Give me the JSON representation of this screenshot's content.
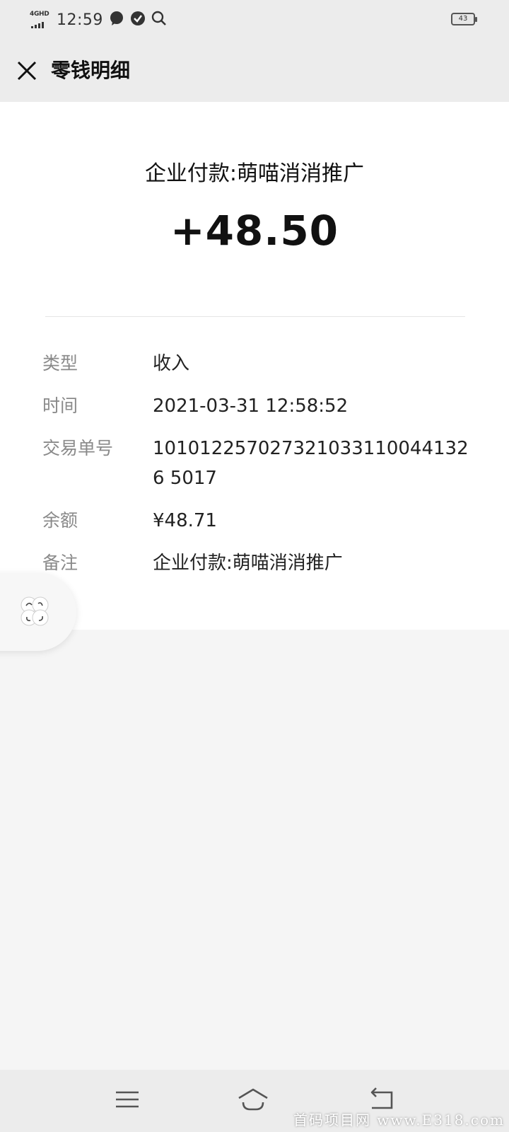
{
  "status_bar": {
    "network": "4GHD",
    "time": "12:59",
    "battery": "43",
    "icons": [
      "message-bubble-icon",
      "check-circle-icon",
      "search-icon"
    ]
  },
  "nav": {
    "title": "零钱明细",
    "close_icon": "close-icon"
  },
  "transaction": {
    "merchant": "企业付款:萌喵消消推广",
    "amount": "+48.50",
    "details": [
      {
        "label": "类型",
        "value": "收入"
      },
      {
        "label": "时间",
        "value": "2021-03-31 12:58:52"
      },
      {
        "label": "交易单号",
        "value": "1010122570273210331100441326 5017"
      },
      {
        "label": "余额",
        "value": "¥48.71"
      },
      {
        "label": "备注",
        "value": "企业付款:萌喵消消推广"
      }
    ]
  },
  "bottom_nav": {
    "icons": [
      "menu-icon",
      "home-icon",
      "back-icon"
    ]
  },
  "watermark": "首码项目网 www.E318.com"
}
